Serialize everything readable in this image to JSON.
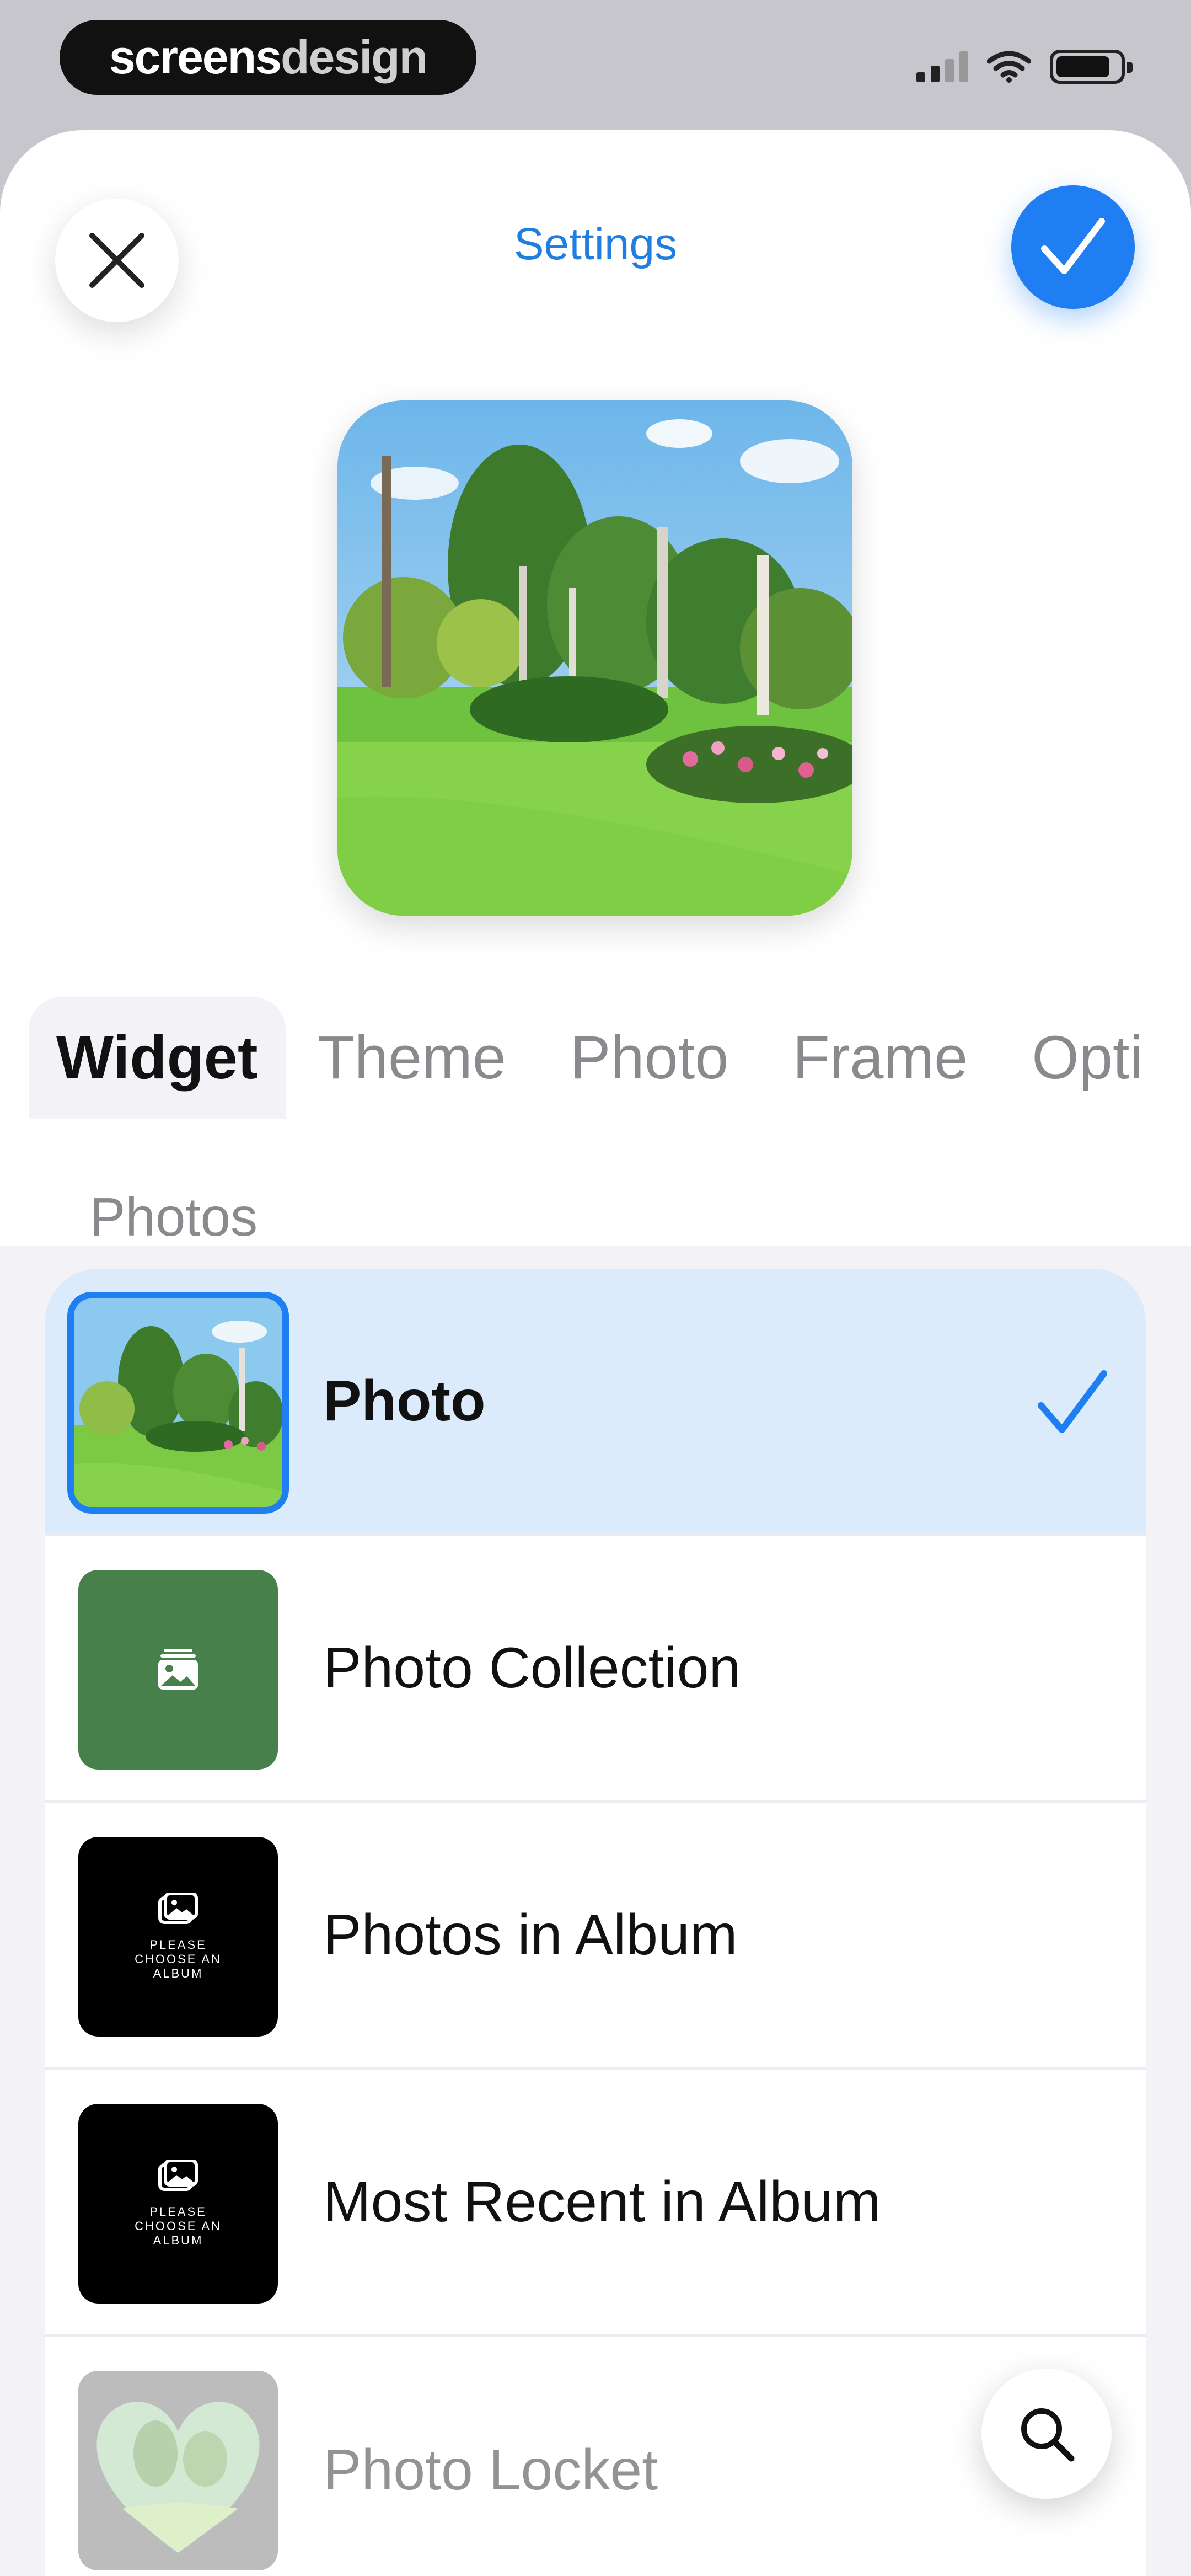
{
  "status_bar": {
    "brand_part1": "screens",
    "brand_part2": "design"
  },
  "header": {
    "title": "Settings"
  },
  "tabs": [
    {
      "label": "Widget",
      "active": true
    },
    {
      "label": "Theme",
      "active": false
    },
    {
      "label": "Photo",
      "active": false
    },
    {
      "label": "Frame",
      "active": false
    },
    {
      "label": "Opti",
      "active": false
    }
  ],
  "section": {
    "title": "Photos"
  },
  "list": [
    {
      "label": "Photo",
      "selected": true
    },
    {
      "label": "Photo Collection",
      "selected": false
    },
    {
      "label": "Photos in Album",
      "selected": false,
      "thumb_text": "PLEASE CHOOSE AN ALBUM"
    },
    {
      "label": "Most Recent in Album",
      "selected": false,
      "thumb_text": "PLEASE CHOOSE AN ALBUM"
    },
    {
      "label": "Photo Locket",
      "selected": false
    }
  ],
  "colors": {
    "accent": "#1e7ef2",
    "title": "#1f7ede",
    "selected_row": "#dcebfb",
    "collection_thumb": "#48804c"
  }
}
